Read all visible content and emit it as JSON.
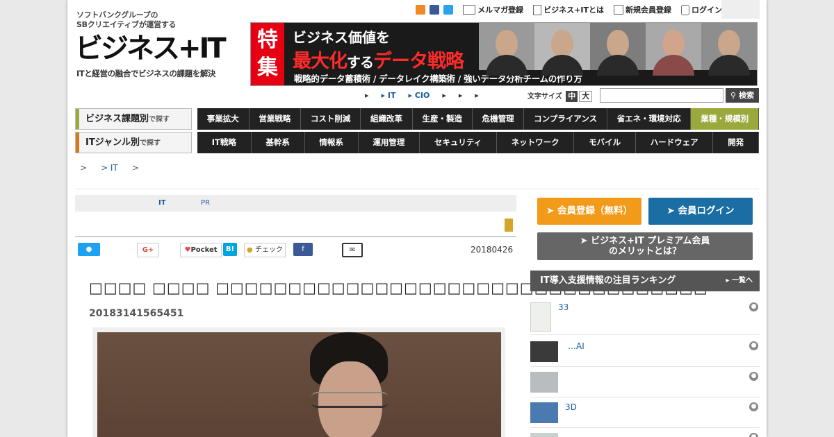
{
  "header": {
    "logo_sub_line1": "ソフトバンクグループの",
    "logo_sub_line2": "SBクリエイティブが運営する",
    "logo_main": "ビジネス+IT",
    "logo_tagline": "ITと経営の融合でビジネスの課題を解決",
    "top_links": [
      "メルマガ登録",
      "ビジネス+ITとは",
      "新規会員登録",
      "ログイン"
    ]
  },
  "banner": {
    "tokushu": "特集",
    "line1": "ビジネス価値を",
    "line2a": "最大化",
    "line2b": "する",
    "line2c": "データ戦略",
    "line3": "戦略的データ蓄積術 / データレイク構築術 / 強いデータ分析チームの作り方"
  },
  "subnav": {
    "items": [
      "▸",
      "▸ IT",
      "▸ CIO",
      "▸",
      "▸",
      "▸"
    ],
    "font_size_label": "文字サイズ",
    "font_mid": "中",
    "font_large": "大",
    "search_button": "検索"
  },
  "nav": {
    "row1_label": "ビジネス課題別",
    "row1_suffix": "で探す",
    "row1_items": [
      "事業拡大",
      "営業戦略",
      "コスト削減",
      "組織改革",
      "生産・製造",
      "危機管理",
      "コンプライアンス",
      "省エネ・環境対応",
      "業種・規模別"
    ],
    "row2_label": "ITジャンル別",
    "row2_suffix": "で探す",
    "row2_items": [
      "IT戦略",
      "基幹系",
      "情報系",
      "運用管理",
      "セキュリティ",
      "ネットワーク",
      "モバイル",
      "ハードウェア",
      "開発"
    ]
  },
  "breadcrumb": {
    "sep1": ">",
    "link": "> IT",
    "sep2": ">"
  },
  "article": {
    "cat_it": "IT",
    "cat_pr": "PR",
    "share_pocket": "Pocket",
    "share_hatena": "B!",
    "share_check": "チェック",
    "share_gplus": "G+",
    "date": "20180426",
    "title": "□□□□ □□□□ □□□□□□□□□□□□□□□□□□□□□□□□□□□□□□□□□□",
    "meta": "20183141565451"
  },
  "sidebar": {
    "register": "会員登録（無料）",
    "login": "会員ログイン",
    "premium_line1": "ビジネス+IT プレミアム会員",
    "premium_line2": "のメリットとは？",
    "ranking_title": "IT導入支援情報の注目ランキング",
    "ranking_more": "一覧へ",
    "ranking": [
      "33",
      "…AI",
      "",
      "3D",
      ""
    ]
  },
  "colors": {
    "accent_orange": "#f29a1a",
    "accent_blue": "#1a6ea3",
    "nav_dark": "#222222",
    "nav_highlight": "#9aa83c",
    "banner_red": "#e60012"
  }
}
